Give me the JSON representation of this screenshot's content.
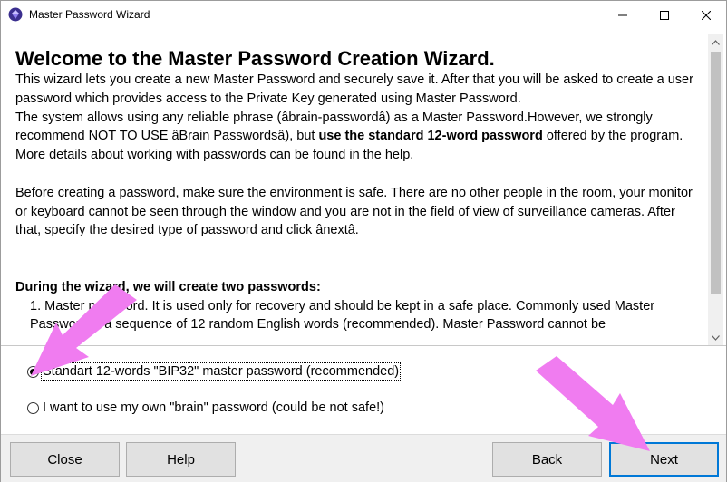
{
  "window": {
    "title": "Master Password Wizard",
    "icon": "app-gem-icon"
  },
  "content": {
    "heading": "Welcome to the Master Password Creation Wizard.",
    "para1": "This wizard lets you create a new Master Password and securely save it. After that you will be asked to create a user password which provides access to the Private Key generated using Master Password.",
    "para2_start": "The system allows using any reliable phrase (âbrain-passwordâ) as a Master Password.However, we strongly recommend NOT TO USE âBrain Passwordsâ), but ",
    "para2_bold": " use the standard 12-word password ",
    "para2_end": " offered by the program.",
    "para3": "More details about working with passwords can be found in the help.",
    "para4": "Before creating a password, make sure the environment is safe. There are no other people in the room, your monitor or keyboard cannot be seen through the window and you are not in the field of view of surveillance cameras. After that, specify the desired type of password and click ânextâ.",
    "during_heading": "During the wizard, we will create two passwords:",
    "list_item1": "1. Master password. It is used only for recovery and should be kept in a safe place. Commonly used Master",
    "list_item1_cont": "Password is a sequence of 12 random English words (recommended). Master Password cannot be"
  },
  "options": {
    "bip32_label": "Standart 12-words \"BIP32\" master password (recommended)",
    "brain_label": "I want to use my own \"brain\" password (could be not safe!)",
    "selected": "bip32"
  },
  "buttons": {
    "close": "Close",
    "help": "Help",
    "back": "Back",
    "next": "Next"
  },
  "colors": {
    "accent": "#0078d7",
    "arrow": "#f07cf0",
    "button_face": "#e1e1e1",
    "bottom_bar": "#f0f0f0"
  }
}
